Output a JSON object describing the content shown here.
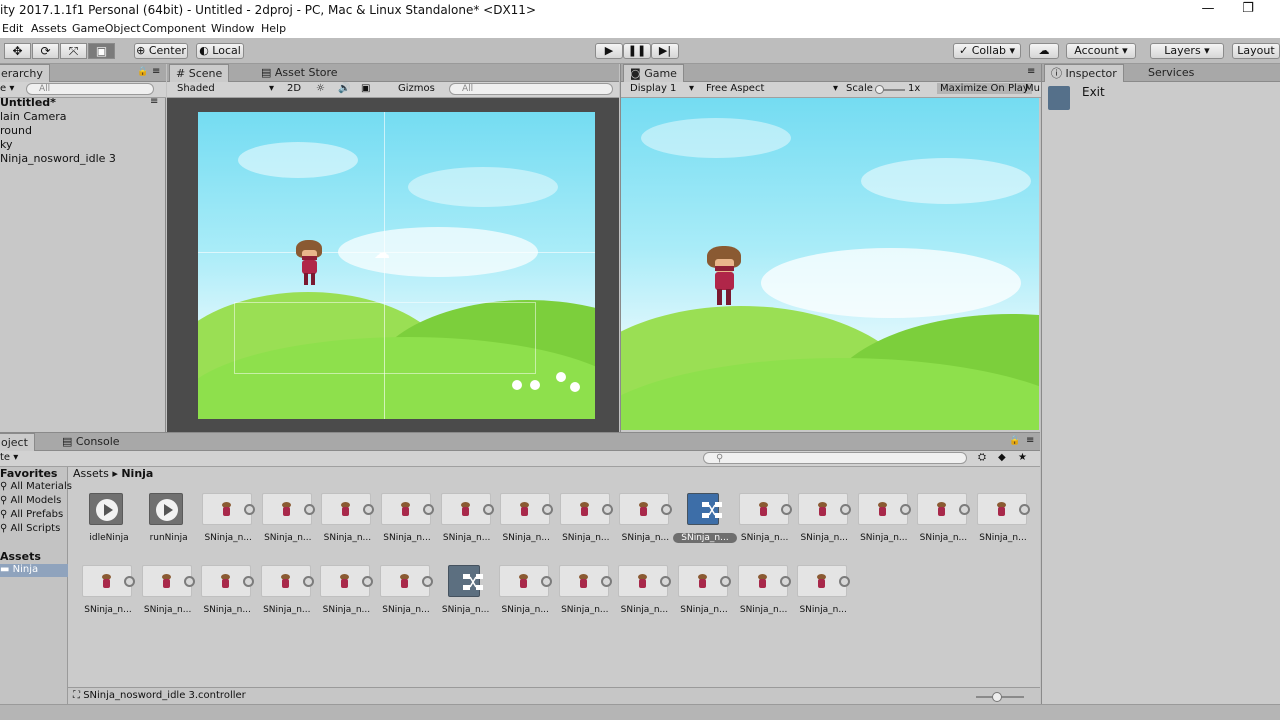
{
  "window": {
    "title": "ity 2017.1.1f1 Personal (64bit) - Untitled - 2dproj - PC, Mac & Linux Standalone* <DX11>",
    "minimize": "—",
    "maximize": "❐"
  },
  "menu": [
    "Edit",
    "Assets",
    "GameObject",
    "Component",
    "Window",
    "Help"
  ],
  "toolbar": {
    "pivot": "Center",
    "space": "Local",
    "collab": "Collab ▾",
    "account": "Account",
    "layers": "Layers",
    "layout": "Layout"
  },
  "hierarchy": {
    "tab": "erarchy",
    "create": "e ▾",
    "search_placeholder": "All",
    "scene": "Untitled*",
    "items": [
      "lain Camera",
      "round",
      "ky",
      "Ninja_nosword_idle 3"
    ]
  },
  "scene_view": {
    "tab_scene": "Scene",
    "tab_store": "Asset Store",
    "shading": "Shaded",
    "mode_2d": "2D",
    "gizmos": "Gizmos",
    "search_placeholder": "All"
  },
  "game_view": {
    "tab": "Game",
    "display": "Display 1",
    "aspect": "Free Aspect",
    "scale_label": "Scale",
    "scale_value": "1x",
    "maximize": "Maximize On Play",
    "mute": "Mu"
  },
  "inspector": {
    "tab": "Inspector",
    "tab_services": "Services",
    "item": "Exit"
  },
  "project": {
    "tab_project": "oject",
    "tab_console": "Console",
    "create": "te ▾",
    "favorites_title": "Favorites",
    "favorites": [
      "All Materials",
      "All Models",
      "All Prefabs",
      "All Scripts"
    ],
    "assets_title": "Assets",
    "folder": "Ninja",
    "breadcrumb_root": "Assets",
    "breadcrumb_current": "Ninja",
    "status_file": "SNinja_nosword_idle 3.controller",
    "row1": [
      {
        "type": "anim",
        "label": "idleNinja"
      },
      {
        "type": "anim",
        "label": "runNinja"
      },
      {
        "type": "sprite",
        "label": "SNinja_n..."
      },
      {
        "type": "sprite",
        "label": "SNinja_n..."
      },
      {
        "type": "sprite",
        "label": "SNinja_n..."
      },
      {
        "type": "sprite",
        "label": "SNinja_n..."
      },
      {
        "type": "sprite",
        "label": "SNinja_n..."
      },
      {
        "type": "sprite",
        "label": "SNinja_n..."
      },
      {
        "type": "sprite",
        "label": "SNinja_n..."
      },
      {
        "type": "sprite",
        "label": "SNinja_n..."
      },
      {
        "type": "controller",
        "label": "SNinja_n...",
        "selected": true
      },
      {
        "type": "sprite",
        "label": "SNinja_n..."
      },
      {
        "type": "sprite",
        "label": "SNinja_n..."
      },
      {
        "type": "sprite",
        "label": "SNinja_n..."
      },
      {
        "type": "sprite",
        "label": "SNinja_n..."
      },
      {
        "type": "sprite",
        "label": "SNinja_n..."
      }
    ],
    "row2": [
      {
        "type": "sprite",
        "label": "SNinja_n..."
      },
      {
        "type": "sprite",
        "label": "SNinja_n..."
      },
      {
        "type": "sprite",
        "label": "SNinja_n..."
      },
      {
        "type": "sprite",
        "label": "SNinja_n..."
      },
      {
        "type": "sprite",
        "label": "SNinja_n..."
      },
      {
        "type": "sprite",
        "label": "SNinja_n..."
      },
      {
        "type": "controller",
        "label": "SNinja_n..."
      },
      {
        "type": "sprite",
        "label": "SNinja_n..."
      },
      {
        "type": "sprite",
        "label": "SNinja_n..."
      },
      {
        "type": "sprite",
        "label": "SNinja_n..."
      },
      {
        "type": "sprite",
        "label": "SNinja_n..."
      },
      {
        "type": "sprite",
        "label": "SNinja_n..."
      },
      {
        "type": "sprite",
        "label": "SNinja_n..."
      }
    ]
  }
}
